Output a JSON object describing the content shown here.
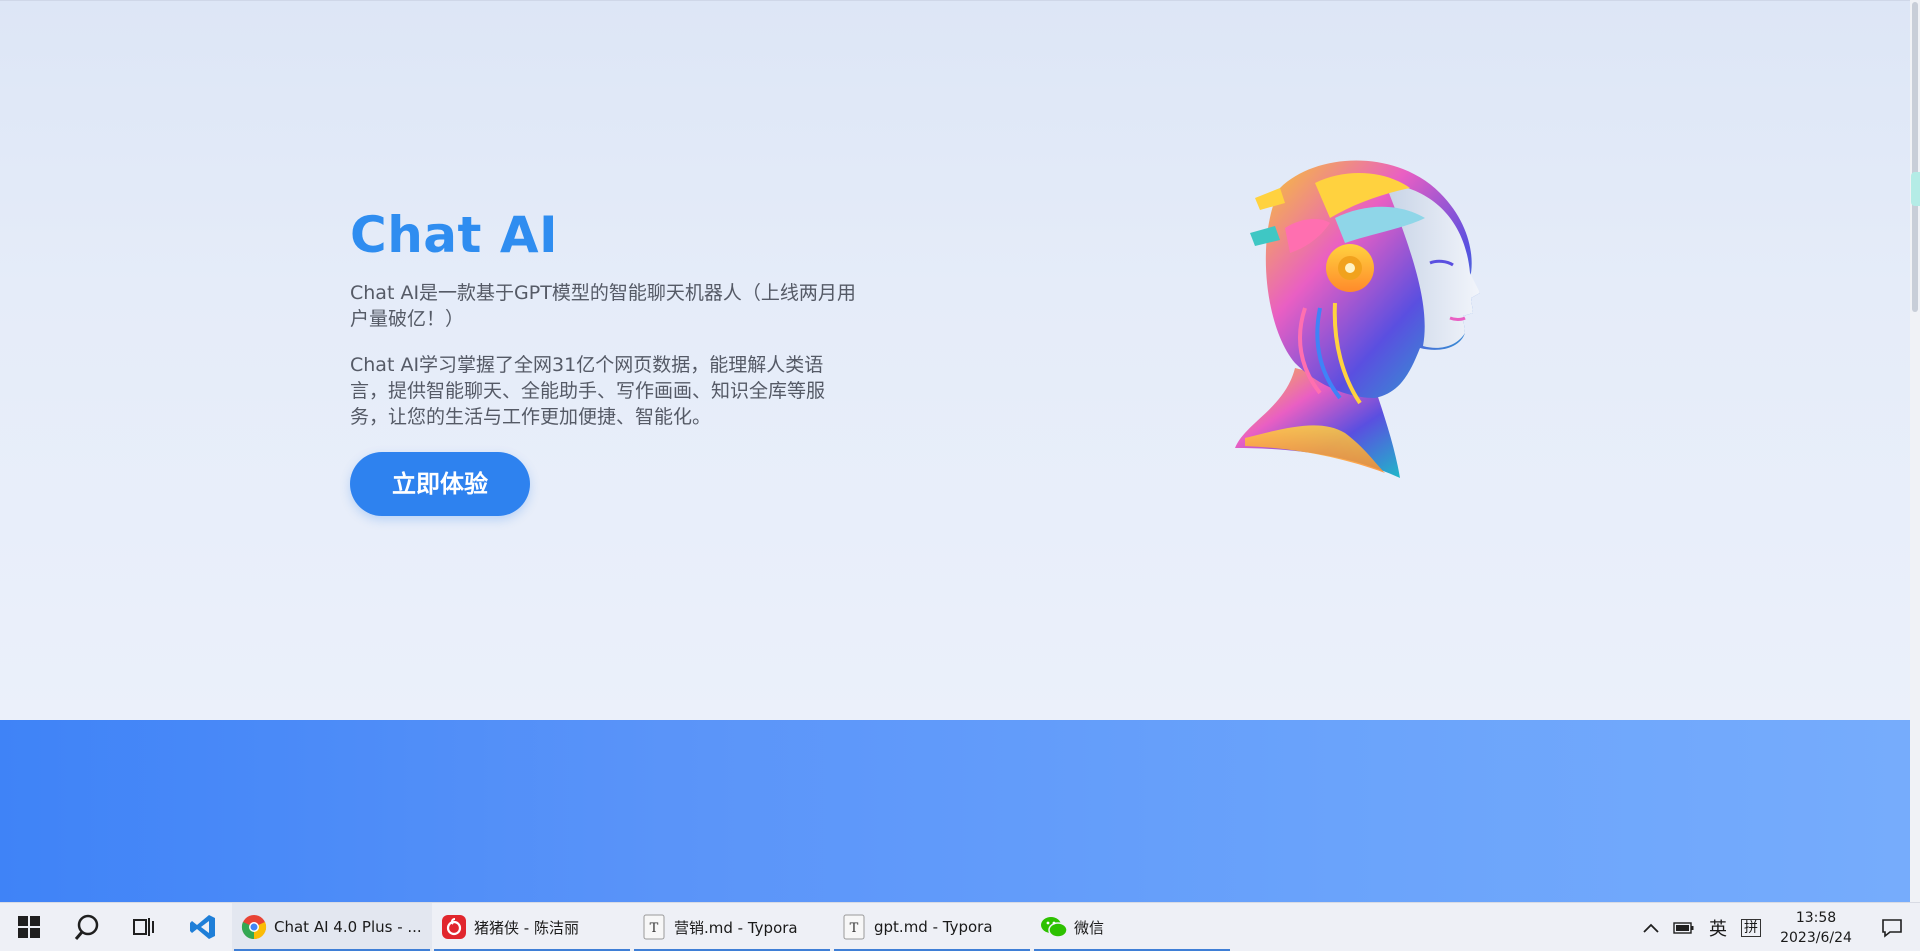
{
  "hero": {
    "title": "Chat AI",
    "paragraph1": "Chat AI是一款基于GPT模型的智能聊天机器人（上线两月用户量破亿！）",
    "paragraph2": "Chat AI学习掌握了全网31亿个网页数据，能理解人类语言，提供智能聊天、全能助手、写作画画、知识全库等服务，让您的生活与工作更加便捷、智能化。",
    "cta_label": "立即体验",
    "illustration_icon": "robot-head-illustration"
  },
  "colors": {
    "accent": "#2e82ef",
    "title": "#2f8df0",
    "band_start": "#3f83f7",
    "band_end": "#76acfc"
  },
  "taskbar": {
    "system_icons": [
      "windows-start-icon",
      "search-icon",
      "task-view-icon",
      "vscode-icon"
    ],
    "apps": [
      {
        "label": "Chat AI 4.0 Plus - ...",
        "icon": "chrome-icon",
        "active": true
      },
      {
        "label": "猪猪侠 - 陈洁丽",
        "icon": "netease-music-icon",
        "active": false
      },
      {
        "label": "营销.md - Typora",
        "icon": "typora-icon",
        "active": false
      },
      {
        "label": "gpt.md - Typora",
        "icon": "typora-icon",
        "active": false
      },
      {
        "label": "微信",
        "icon": "wechat-icon",
        "active": false
      }
    ],
    "tray": {
      "ime_lang": "英",
      "ime_mode": "拼",
      "time": "13:58",
      "date": "2023/6/24"
    }
  }
}
